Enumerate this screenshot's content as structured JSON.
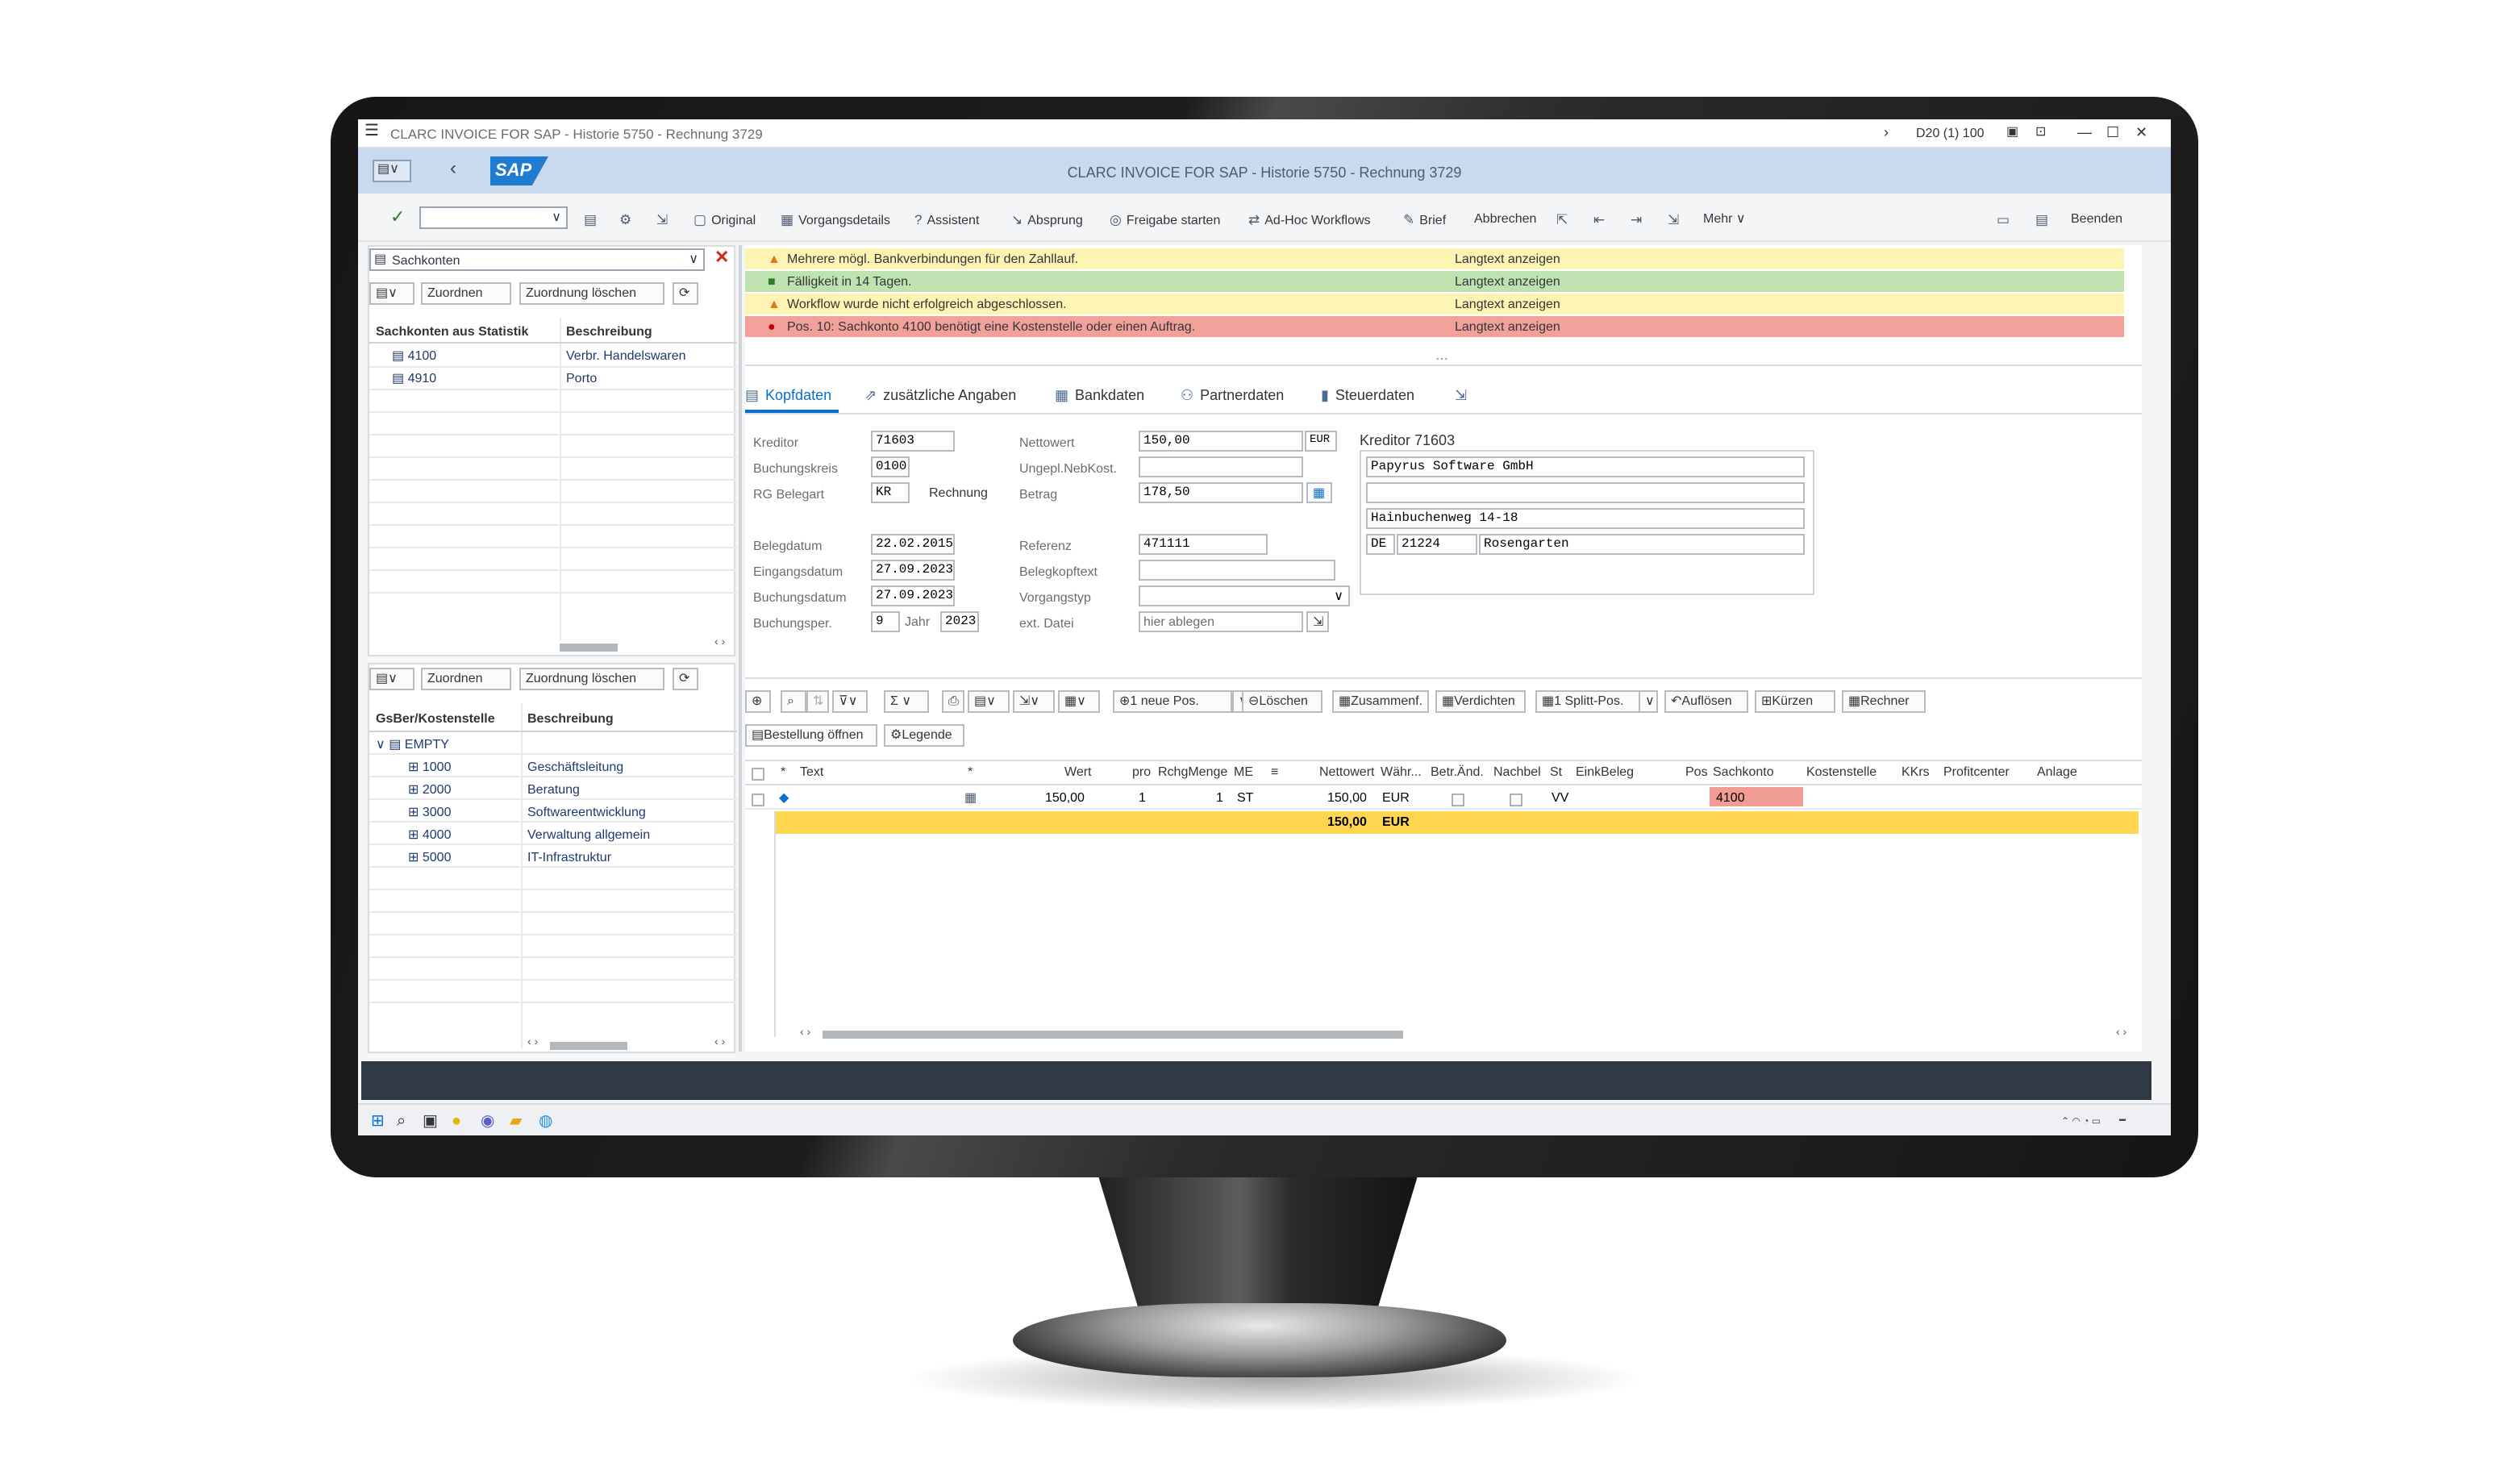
{
  "window": {
    "title": "CLARC INVOICE FOR SAP - Historie 5750 - Rechnung 3729",
    "system": "D20 (1) 100"
  },
  "shell": {
    "title": "CLARC INVOICE FOR SAP - Historie 5750 - Rechnung 3729",
    "logo": "SAP"
  },
  "toolbar": {
    "original": "Original",
    "vorgangsdetails": "Vorgangsdetails",
    "assistent": "Assistent",
    "absprung": "Absprung",
    "freigabe": "Freigabe starten",
    "adhoc": "Ad-Hoc Workflows",
    "brief": "Brief",
    "abbrechen": "Abbrechen",
    "mehr": "Mehr",
    "beenden": "Beenden"
  },
  "left_top": {
    "select_value": "Sachkonten",
    "zuordnen": "Zuordnen",
    "zuordnung_loeschen": "Zuordnung löschen",
    "col1": "Sachkonten aus Statistik",
    "col2": "Beschreibung",
    "rows": [
      {
        "konto": "4100",
        "beschreibung": "Verbr. Handelswaren"
      },
      {
        "konto": "4910",
        "beschreibung": "Porto"
      }
    ]
  },
  "left_bottom": {
    "zuordnen": "Zuordnen",
    "zuordnung_loeschen": "Zuordnung löschen",
    "col1": "GsBer/Kostenstelle",
    "col2": "Beschreibung",
    "root": "EMPTY",
    "rows": [
      {
        "id": "1000",
        "beschreibung": "Geschäftsleitung"
      },
      {
        "id": "2000",
        "beschreibung": "Beratung"
      },
      {
        "id": "3000",
        "beschreibung": "Softwareentwicklung"
      },
      {
        "id": "4000",
        "beschreibung": "Verwaltung allgemein"
      },
      {
        "id": "5000",
        "beschreibung": "IT-Infrastruktur"
      }
    ]
  },
  "messages": [
    {
      "text": "Mehrere mögl. Bankverbindungen für den Zahllauf.",
      "link": "Langtext anzeigen",
      "type": "warning",
      "color": "#fdf3b3"
    },
    {
      "text": "Fälligkeit in 14 Tagen.",
      "link": "Langtext anzeigen",
      "type": "success",
      "color": "#bfe3b0"
    },
    {
      "text": "Workflow wurde nicht erfolgreich abgeschlossen.",
      "link": "Langtext anzeigen",
      "type": "warning",
      "color": "#fdf3b3"
    },
    {
      "text": "Pos. 10: Sachkonto 4100 benötigt eine Kostenstelle oder einen Auftrag.",
      "link": "Langtext anzeigen",
      "type": "error",
      "color": "#f4a09a"
    }
  ],
  "tabs": [
    "Kopfdaten",
    "zusätzliche Angaben",
    "Bankdaten",
    "Partnerdaten",
    "Steuerdaten"
  ],
  "form": {
    "kreditor_label": "Kreditor",
    "kreditor": "71603",
    "buchungskreis_label": "Buchungskreis",
    "buchungskreis": "0100",
    "rg_belegart_label": "RG Belegart",
    "rg_belegart": "KR",
    "rg_belegart_text": "Rechnung",
    "belegdatum_label": "Belegdatum",
    "belegdatum": "22.02.2015",
    "eingangsdatum_label": "Eingangsdatum",
    "eingangsdatum": "27.09.2023",
    "buchungsdatum_label": "Buchungsdatum",
    "buchungsdatum": "27.09.2023",
    "buchungsper_label": "Buchungsper.",
    "buchungsper": "9",
    "jahr_label": "Jahr",
    "jahr": "2023",
    "nettowert_label": "Nettowert",
    "nettowert": "150,00",
    "waehrung": "EUR",
    "nebkost_label": "Ungepl.NebKost.",
    "nebkost": "",
    "betrag_label": "Betrag",
    "betrag": "178,50",
    "referenz_label": "Referenz",
    "referenz": "471111",
    "belegkopftext_label": "Belegkopftext",
    "belegkopftext": "",
    "vorgangstyp_label": "Vorgangstyp",
    "vorgangstyp": "",
    "extdatei_label": "ext. Datei",
    "extdatei": "hier ablegen"
  },
  "kreditor_box": {
    "title": "Kreditor 71603",
    "name": "Papyrus Software GmbH",
    "strasse": "Hainbuchenweg 14-18",
    "land": "DE",
    "plz": "21224",
    "ort": "Rosengarten"
  },
  "table_toolbar": {
    "neue_pos": "1 neue Pos.",
    "loeschen": "Löschen",
    "zusammenf": "Zusammenf.",
    "verdichten": "Verdichten",
    "splitt": "1 Splitt-Pos.",
    "aufloesen": "Auflösen",
    "kuerzen": "Kürzen",
    "rechner": "Rechner",
    "bestellung": "Bestellung öffnen",
    "legende": "Legende"
  },
  "table": {
    "headers": {
      "text": "Text",
      "wert": "Wert",
      "pro": "pro",
      "rchgmenge": "RchgMenge",
      "me": "ME",
      "nettowert": "Nettowert",
      "waehr": "Währ...",
      "betr": "Betr.Änd.",
      "nachbel": "Nachbel",
      "st": "St",
      "einkbeleg": "EinkBeleg",
      "pos": "Pos",
      "sachkonto": "Sachkonto",
      "kostenstelle": "Kostenstelle",
      "kkrs": "KKrs",
      "profitcenter": "Profitcenter",
      "anlage": "Anlage"
    },
    "row": {
      "wert": "150,00",
      "pro": "1",
      "rchgmenge": "1",
      "me": "ST",
      "nettowert": "150,00",
      "waehr": "EUR",
      "st": "VV",
      "sachkonto": "4100"
    },
    "total": {
      "nettowert": "150,00",
      "waehr": "EUR"
    }
  },
  "colors": {
    "shell": "#c9daf0",
    "total_row": "#ffd64f",
    "error_cell": "#f19c95",
    "accent": "#0a6ed1"
  }
}
